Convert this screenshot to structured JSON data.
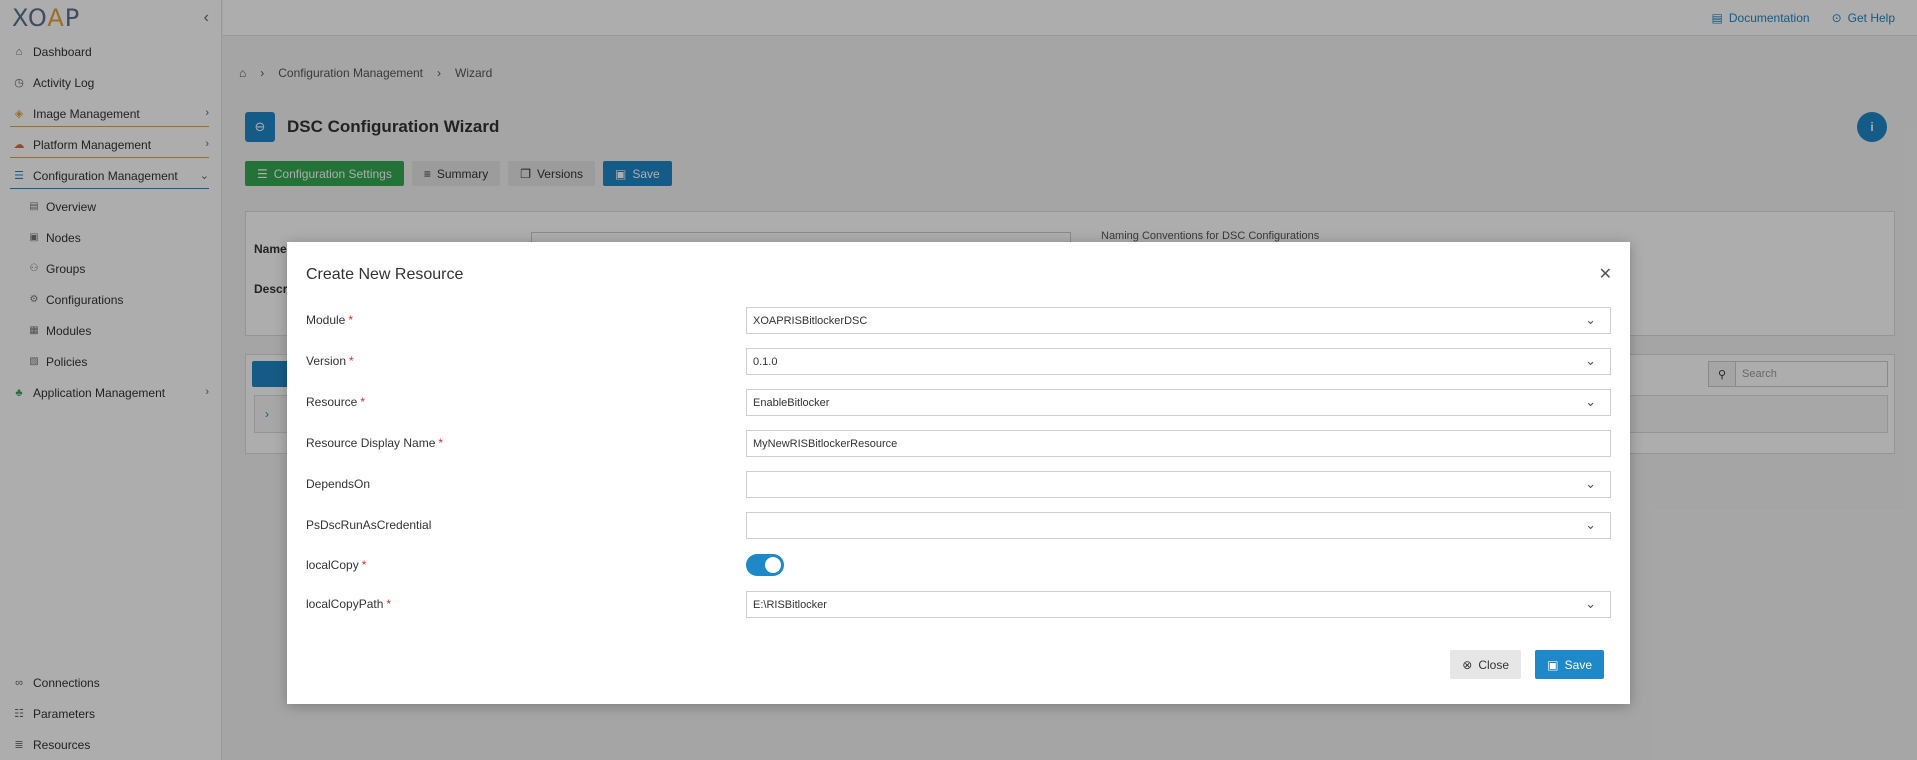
{
  "app": {
    "logo": "XOAP",
    "collapse_icon": "chevron-left-icon"
  },
  "sidebar": {
    "items": [
      {
        "label": "Dashboard",
        "icon": "home-icon"
      },
      {
        "label": "Activity Log",
        "icon": "clock-icon"
      },
      {
        "label": "Image Management",
        "icon": "layers-icon"
      },
      {
        "label": "Platform Management",
        "icon": "cloud-icon"
      },
      {
        "label": "Configuration Management",
        "icon": "config-icon"
      }
    ],
    "sub_items": [
      {
        "label": "Overview",
        "icon": "overview-icon"
      },
      {
        "label": "Nodes",
        "icon": "nodes-icon"
      },
      {
        "label": "Groups",
        "icon": "groups-icon"
      },
      {
        "label": "Configurations",
        "icon": "gear-icon"
      },
      {
        "label": "Modules",
        "icon": "modules-icon"
      },
      {
        "label": "Policies",
        "icon": "policies-icon"
      }
    ],
    "app_mgmt": {
      "label": "Application Management",
      "icon": "apps-icon"
    },
    "bottom": [
      {
        "label": "Connections",
        "icon": "link-icon"
      },
      {
        "label": "Parameters",
        "icon": "sliders-icon"
      },
      {
        "label": "Resources",
        "icon": "list-icon"
      }
    ]
  },
  "topbar": {
    "documentation": "Documentation",
    "get_help": "Get Help"
  },
  "breadcrumb": {
    "level1": "Configuration Management",
    "level2": "Wizard"
  },
  "page": {
    "title": "DSC Configuration Wizard",
    "info_label": "i"
  },
  "tabs": {
    "configuration_settings": "Configuration Settings",
    "summary": "Summary",
    "versions": "Versions",
    "save": "Save"
  },
  "card": {
    "name_label": "Name",
    "description_label": "Descrip",
    "naming_text": "Naming Conventions for DSC Configurations"
  },
  "table": {
    "search_placeholder": "Search"
  },
  "modal": {
    "title": "Create New Resource",
    "fields": {
      "module": {
        "label": "Module",
        "value": "XOAPRISBitlockerDSC"
      },
      "version": {
        "label": "Version",
        "value": "0.1.0"
      },
      "resource": {
        "label": "Resource",
        "value": "EnableBitlocker"
      },
      "display_name": {
        "label": "Resource Display Name",
        "value": "MyNewRISBitlockerResource"
      },
      "depends_on": {
        "label": "DependsOn",
        "value": ""
      },
      "run_as": {
        "label": "PsDscRunAsCredential",
        "value": ""
      },
      "local_copy": {
        "label": "localCopy",
        "enabled": true
      },
      "local_copy_path": {
        "label": "localCopyPath",
        "value": "E:\\RISBitlocker"
      }
    },
    "close_label": "Close",
    "save_label": "Save"
  },
  "colors": {
    "accent": "#1e88c8",
    "success": "#34a853",
    "brand_orange": "#e0a43c",
    "required": "#d32f2f"
  }
}
